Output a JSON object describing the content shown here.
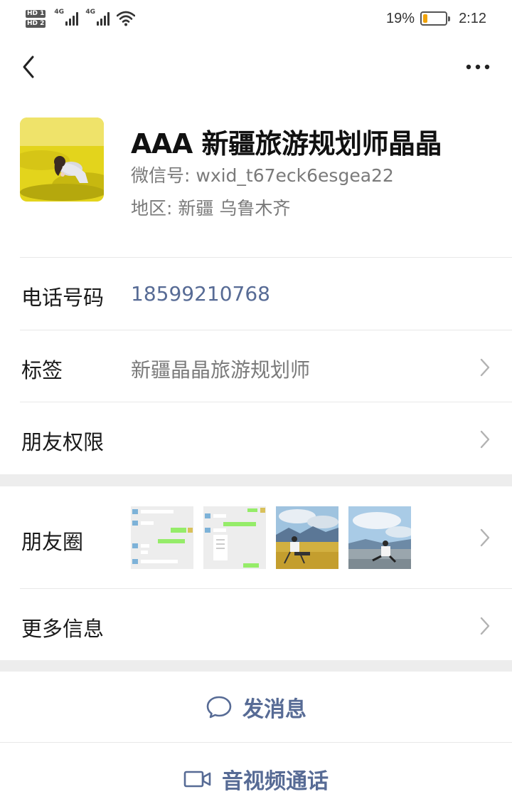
{
  "status_bar": {
    "sim1": "HD 1",
    "sim2": "HD 2",
    "net1": "4G",
    "net2": "4G",
    "battery_percent": "19%",
    "battery_level": 0.19,
    "time": "2:12"
  },
  "nav": {
    "back_icon": "chevron-left-icon",
    "more_icon": "ellipsis-icon"
  },
  "profile": {
    "name": "AAA 新疆旅游规划师晶晶",
    "wechat_id": "微信号: wxid_t67eck6esgea22",
    "region": "地区: 新疆  乌鲁木齐"
  },
  "rows": {
    "phone_label": "电话号码",
    "phone_value": "18599210768",
    "tags_label": "标签",
    "tags_value": "新疆晶晶旅游规划师",
    "permissions_label": "朋友权限",
    "moments_label": "朋友圈",
    "more_info_label": "更多信息"
  },
  "actions": {
    "message_label": "发消息",
    "message_icon": "chat-bubble-icon",
    "call_label": "音视频通话",
    "call_icon": "video-camera-icon"
  },
  "colors": {
    "link": "#576b95",
    "secondary_text": "#7a7a7a",
    "section_gap": "#ededed",
    "battery": "#f0a30a"
  }
}
